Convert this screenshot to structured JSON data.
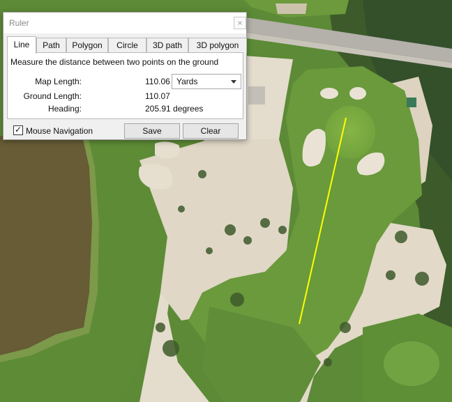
{
  "window": {
    "title": "Ruler",
    "close_glyph": "×"
  },
  "tabs": [
    {
      "label": "Line",
      "active": true
    },
    {
      "label": "Path"
    },
    {
      "label": "Polygon"
    },
    {
      "label": "Circle"
    },
    {
      "label": "3D path"
    },
    {
      "label": "3D polygon"
    }
  ],
  "panel": {
    "description": "Measure the distance between two points on the ground",
    "map_length": {
      "label": "Map Length:",
      "value": "110.06"
    },
    "units": {
      "selected": "Yards"
    },
    "ground_length": {
      "label": "Ground Length:",
      "value": "110.07"
    },
    "heading": {
      "label": "Heading:",
      "value": "205.91 degrees"
    }
  },
  "footer": {
    "mouse_navigation": {
      "label": "Mouse Navigation",
      "checked": true,
      "check_glyph": "✓"
    },
    "save_label": "Save",
    "clear_label": "Clear"
  },
  "colors": {
    "measure_line": "#ffff00",
    "fairway": "#6a9a3c",
    "rough": "#5c8a36",
    "sand": "#e4dccc",
    "water": "#675c35",
    "road": "#b4b0aa"
  },
  "icons": {
    "dropdown": "chevron-down-icon",
    "check": "check-icon"
  }
}
